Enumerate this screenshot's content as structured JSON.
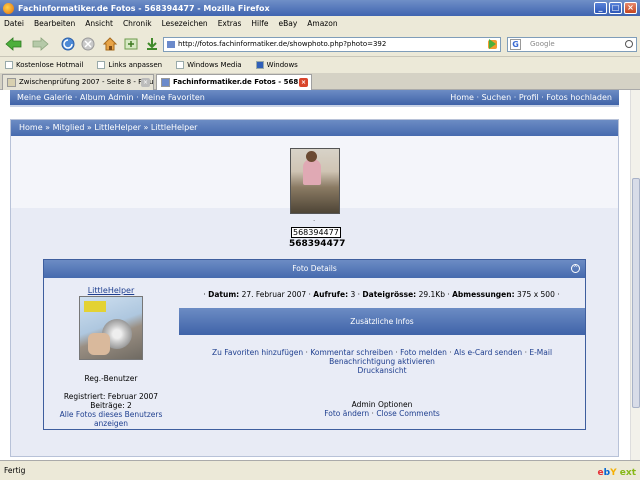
{
  "window": {
    "title": "Fachinformatiker.de Fotos - 568394477 - Mozilla Firefox"
  },
  "menu": [
    "Datei",
    "Bearbeiten",
    "Ansicht",
    "Chronik",
    "Lesezeichen",
    "Extras",
    "Hilfe",
    "eBay",
    "Amazon"
  ],
  "nav": {
    "url": "http://fotos.fachinformatiker.de/showphoto.php?photo=392",
    "search_placeholder": "Google"
  },
  "bookmarks": [
    "Kostenlose Hotmail",
    "Links anpassen",
    "Windows Media",
    "Windows"
  ],
  "tabs": [
    {
      "label": "Zwischenprüfung 2007 - Seite 8 - Foru...",
      "active": false
    },
    {
      "label": "Fachinformatiker.de Fotos - 568...",
      "active": true
    }
  ],
  "sitenav": {
    "left": [
      "Meine Galerie",
      "Album Admin",
      "Meine Favoriten"
    ],
    "right": [
      "Home",
      "Suchen",
      "Profil",
      "Fotos hochladen"
    ],
    "sep": " · "
  },
  "breadcrumb": "Home » Mitglied » LittleHelper » LittleHelper",
  "photo": {
    "dot": "·",
    "id_box": "568394477",
    "id_bold": "568394477"
  },
  "details": {
    "header": "Foto Details",
    "username": "LittleHelper",
    "rank": "Reg.-Benutzer",
    "registered": "Registriert: Februar 2007",
    "posts": "Beiträge: 2",
    "all_photos": "Alle Fotos dieses Benutzers anzeigen",
    "info": {
      "date_label": "Datum:",
      "date": "27. Februar 2007",
      "views_label": "Aufrufe:",
      "views": "3",
      "size_label": "Dateigrösse:",
      "size": "29.1Kb",
      "dims_label": "Abmessungen:",
      "dims": "375 x 500"
    },
    "extra_header": "Zusätzliche Infos",
    "actions": [
      "Zu Favoriten hinzufügen",
      "Kommentar schreiben",
      "Foto melden",
      "Als e-Card senden",
      "E-Mail Benachrichtigung aktivieren"
    ],
    "print": "Druckansicht",
    "admin_title": "Admin Optionen",
    "admin_links": [
      "Foto ändern",
      "Close Comments"
    ]
  },
  "status": {
    "text": "Fertig"
  }
}
